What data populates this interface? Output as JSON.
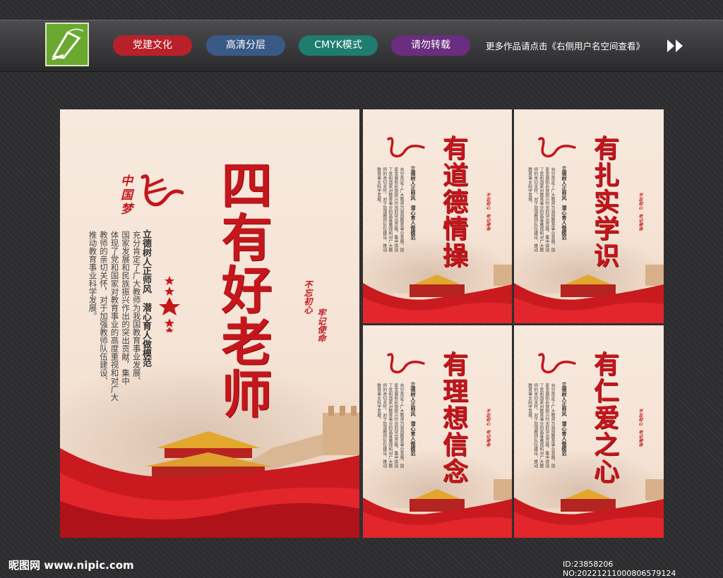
{
  "topbar": {
    "tags": [
      {
        "label": "党建文化",
        "color": "#b8202a"
      },
      {
        "label": "高清分层",
        "color": "#3a5a86"
      },
      {
        "label": "CMYK模式",
        "color": "#1e7d6e"
      },
      {
        "label": "请勿转载",
        "color": "#6a2d7f"
      }
    ],
    "notice": "更多作品请点击《右侧用户名空间查看》"
  },
  "main_poster": {
    "title": "四有好老师",
    "dream_logo": "中国梦",
    "slogan": "立德树人正师风　潜心育人做模范",
    "paragraph": [
      "充分肯定了广大教师为我国教育事业发展、",
      "国家发展和民族振兴作出的突出贡献，集中",
      "体现了党和国家对教育事业的高度重视和对广大",
      "教师的亲切关怀，对于加强教师队伍建设、",
      "推动教育事业科学发展。"
    ],
    "badge": [
      "不忘初心",
      "牢记使命"
    ]
  },
  "small_posters": [
    {
      "title": "有道德情操"
    },
    {
      "title": "有扎实学识"
    },
    {
      "title": "有理想信念"
    },
    {
      "title": "有仁爱之心"
    }
  ],
  "small_common": {
    "slogan": "立德树人正师风　潜心育人做模范",
    "paragraph": "充分肯定了广大教师为我国教育事业发展、国家发展和民族振兴作出的突出贡献，集中体现了党和国家对教育事业的高度重视和对广大教师的亲切关怀，对于加强教师队伍建设、推动教育事业科学发展。",
    "badge": "不忘初心　牢记使命"
  },
  "footer": {
    "site": "昵图网 www.nipic.com",
    "id": "ID:23858206 NO:20221211000806579124"
  },
  "colors": {
    "red": "#c4161c",
    "paper": "#f5e4d6",
    "background": "#2d2d2f"
  }
}
